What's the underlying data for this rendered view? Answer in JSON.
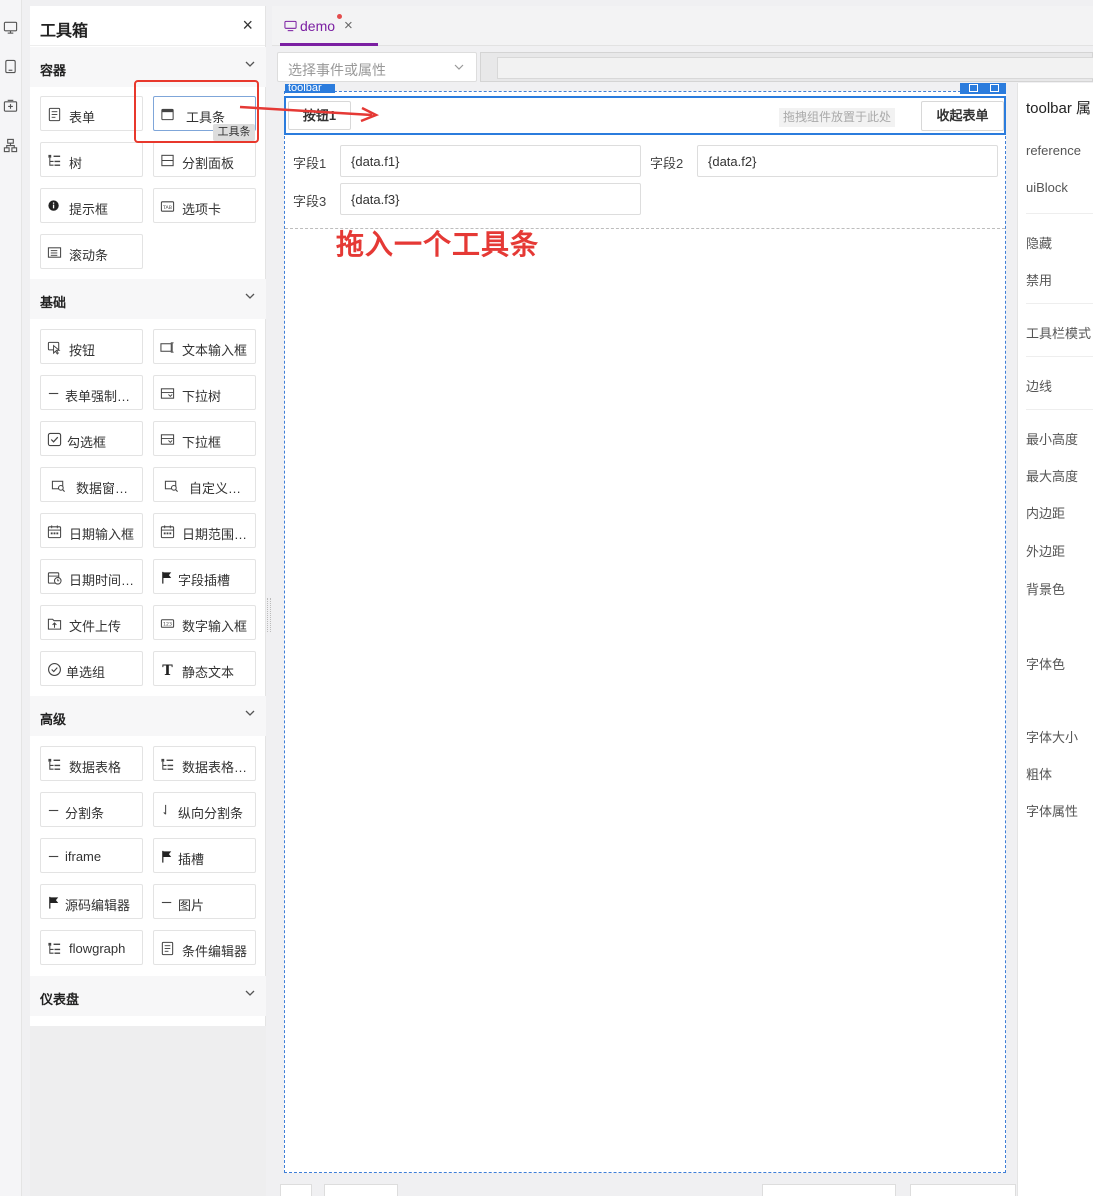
{
  "rail": {
    "icons": [
      "desktop-icon",
      "tablet-icon",
      "add-component-icon",
      "network-icon"
    ]
  },
  "toolbox": {
    "title": "工具箱",
    "close": "×",
    "sections": [
      {
        "label": "容器",
        "items": [
          "表单",
          "工具条",
          "树",
          "分割面板",
          "提示框",
          "选项卡",
          "滚动条"
        ]
      },
      {
        "label": "基础",
        "items": [
          "按钮",
          "文本输入框",
          "表单强制…",
          "下拉树",
          "勾选框",
          "下拉框",
          "数据窗…",
          "自定义…",
          "日期输入框",
          "日期范围…",
          "日期时间…",
          "字段插槽",
          "文件上传",
          "数字输入框",
          "单选组",
          "静态文本"
        ]
      },
      {
        "label": "高级",
        "items": [
          "数据表格",
          "数据表格…",
          "分割条",
          "纵向分割条",
          "iframe",
          "插槽",
          "源码编辑器",
          "图片",
          "flowgraph",
          "条件编辑器"
        ]
      },
      {
        "label": "仪表盘",
        "items": []
      }
    ],
    "tooltip": "工具条"
  },
  "editor": {
    "tab": {
      "label": "demo",
      "close": "×"
    },
    "event_select_placeholder": "选择事件或属性",
    "component_tag": "toolbar",
    "toolbar": {
      "button1": "按钮1",
      "drop_hint": "拖拽组件放置于此处",
      "collapse": "收起表单"
    },
    "fields": [
      {
        "label": "字段1",
        "value": "{data.f1}"
      },
      {
        "label": "字段2",
        "value": "{data.f2}"
      },
      {
        "label": "字段3",
        "value": "{data.f3}"
      }
    ],
    "annotation": "拖入一个工具条"
  },
  "props": {
    "title": "toolbar 属",
    "labels": [
      "reference",
      "uiBlock",
      "隐藏",
      "禁用",
      "工具栏模式",
      "边线",
      "最小高度",
      "最大高度",
      "内边距",
      "外边距",
      "背景色",
      "字体色",
      "字体大小",
      "粗体",
      "字体属性"
    ]
  },
  "colors": {
    "accent": "#7b1fa2",
    "selection": "#2b7cdd",
    "annotation": "#e53935"
  }
}
